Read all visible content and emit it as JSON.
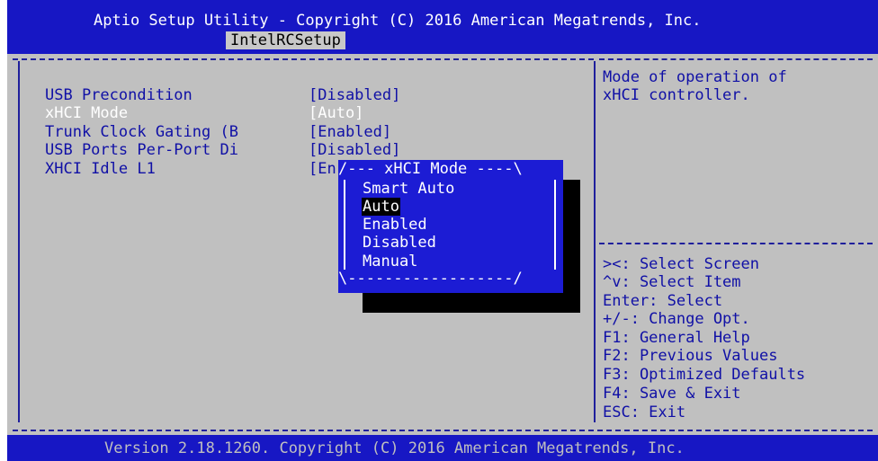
{
  "header": {
    "title": "Aptio Setup Utility - Copyright (C) 2016 American Megatrends, Inc.",
    "active_tab": "IntelRCSetup"
  },
  "settings": [
    {
      "name": "USB Precondition",
      "value": "[Disabled]",
      "selected": false
    },
    {
      "name": "xHCI Mode",
      "value": "[Auto]",
      "selected": true
    },
    {
      "name": "Trunk Clock Gating (B",
      "value": "[Enabled]",
      "selected": false
    },
    {
      "name": "USB Ports Per-Port Di",
      "value": "[Disabled]",
      "selected": false
    },
    {
      "name": "XHCI Idle L1",
      "value": "[En",
      "selected": false
    }
  ],
  "help": {
    "description": "Mode of operation of\nxHCI controller.",
    "keys": [
      "><: Select Screen",
      "^v: Select Item",
      "Enter: Select",
      "+/-: Change Opt.",
      "F1: General Help",
      "F2: Previous Values",
      "F3: Optimized Defaults",
      "F4: Save & Exit",
      "ESC: Exit"
    ]
  },
  "popup": {
    "top_border": "/--- xHCI Mode ----\\",
    "bottom_border": "\\------------------/",
    "options": [
      "Smart Auto",
      "Auto",
      "Enabled",
      "Disabled",
      "Manual"
    ],
    "highlighted": "Auto"
  },
  "footer": {
    "text": "Version 2.18.1260. Copyright (C) 2016 American Megatrends, Inc."
  },
  "colors": {
    "bar_blue": "#1717c4",
    "panel_gray": "#c0c0c0",
    "text_blue": "#1010a6",
    "popup_blue": "#1c1cd4",
    "highlight": "#000000"
  }
}
